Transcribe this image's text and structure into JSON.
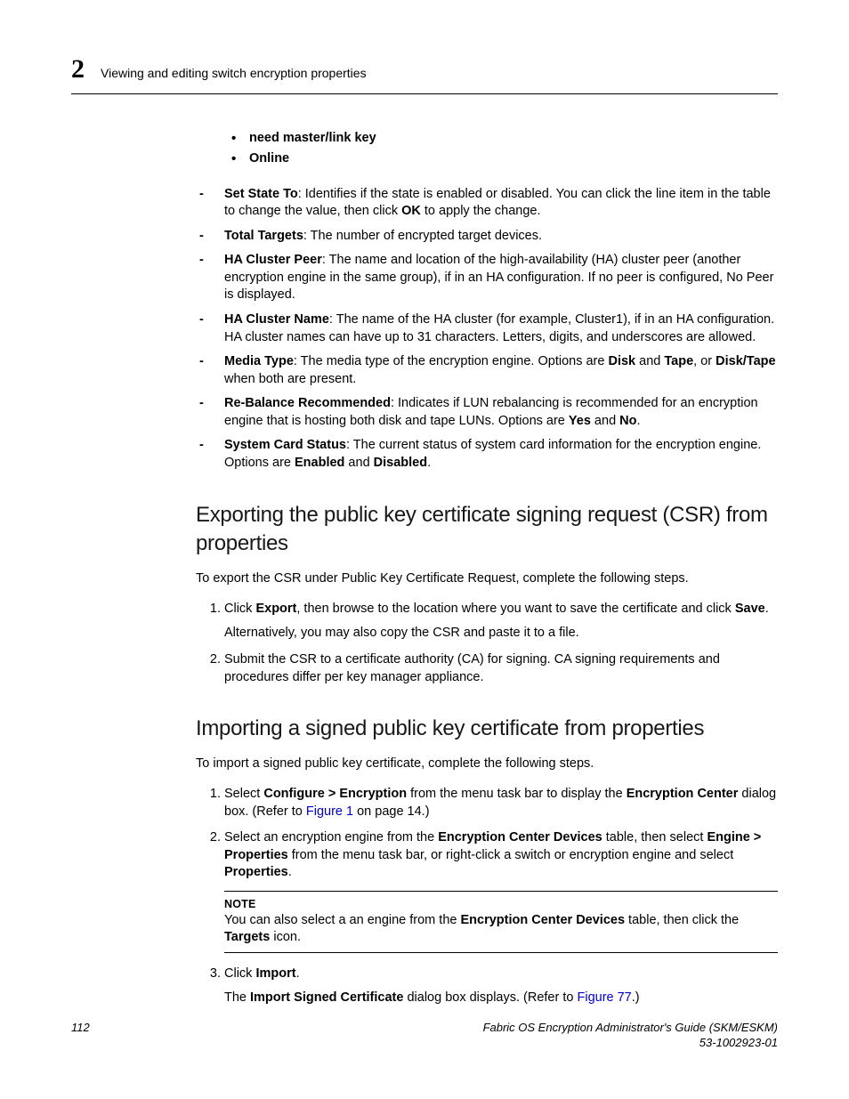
{
  "header": {
    "chapter_number": "2",
    "chapter_title": "Viewing and editing switch encryption properties"
  },
  "sub_bullets": [
    "need master/link key",
    "Online"
  ],
  "dashes": {
    "set_state": {
      "label": "Set State To",
      "text": ": Identifies if the state is enabled or disabled. You can click the line item in the table to change the value, then click ",
      "ok": "OK",
      "text2": " to apply the change."
    },
    "total_targets": {
      "label": "Total Targets",
      "text": ": The number of encrypted target devices."
    },
    "ha_peer": {
      "label": "HA Cluster Peer",
      "text": ": The name and location of the high-availability (HA) cluster peer (another encryption engine in the same group), if in an HA configuration. If no peer is configured, No Peer is displayed."
    },
    "ha_name": {
      "label": "HA Cluster Name",
      "text": ": The name of the HA cluster (for example, Cluster1), if in an HA configuration. HA cluster names can have up to 31 characters. Letters, digits, and underscores are allowed."
    },
    "media": {
      "label": "Media Type",
      "text1": ": The media type of the encryption engine. Options are ",
      "disk": "Disk",
      "and": " and ",
      "tape": "Tape",
      "or": ", or ",
      "disktape": "Disk/Tape",
      "text2": " when both are present."
    },
    "rebalance": {
      "label": "Re-Balance Recommended",
      "text1": ": Indicates if LUN rebalancing is recommended for an encryption engine that is hosting both disk and tape LUNs. Options are ",
      "yes": "Yes",
      "and": " and ",
      "no": "No",
      "dot": "."
    },
    "syscard": {
      "label": "System Card Status",
      "text1": ": The current status of system card information for the encryption engine. Options are ",
      "enabled": "Enabled",
      "and": " and ",
      "disabled": "Disabled",
      "dot": "."
    }
  },
  "section1": {
    "title": "Exporting the public key certificate signing request (CSR) from properties",
    "intro": "To export the CSR under Public Key Certificate Request, complete the following steps.",
    "step1": {
      "p1a": "Click ",
      "export": "Export",
      "p1b": ", then browse to the location where you want to save the certificate and click ",
      "save": "Save",
      "dot": ".",
      "p2": "Alternatively, you may also copy the CSR and paste it to a file."
    },
    "step2": "Submit the CSR to a certificate authority (CA) for signing. CA signing requirements and procedures differ per key manager appliance."
  },
  "section2": {
    "title": "Importing a signed public key certificate from properties",
    "intro": "To import a signed public key certificate, complete the following steps.",
    "step1": {
      "a": "Select ",
      "menu": "Configure > Encryption",
      "b": " from the menu task bar to display the ",
      "center": "Encryption Center",
      "c": " dialog box. (Refer to ",
      "ref": "Figure 1",
      "d": " on page 14.)"
    },
    "step2": {
      "a": "Select an encryption engine from the ",
      "devices": "Encryption Center Devices",
      "b": " table, then select ",
      "engprop": "Engine > Properties",
      "c": " from the menu task bar, or right-click a switch or encryption engine and select ",
      "props": "Properties",
      "dot": "."
    },
    "note": {
      "label": "NOTE",
      "a": "You can also select a an engine from the ",
      "devices": "Encryption Center Devices",
      "b": " table, then click the ",
      "targets": "Targets",
      "c": " icon."
    },
    "step3": {
      "a": "Click ",
      "import": "Import",
      "dot": ".",
      "p2a": "The ",
      "dlg": "Import Signed Certificate",
      "p2b": " dialog box displays. (Refer to ",
      "ref": "Figure 77",
      "p2c": ".)"
    }
  },
  "footer": {
    "page": "112",
    "title": "Fabric OS Encryption Administrator's Guide (SKM/ESKM)",
    "docnum": "53-1002923-01"
  }
}
